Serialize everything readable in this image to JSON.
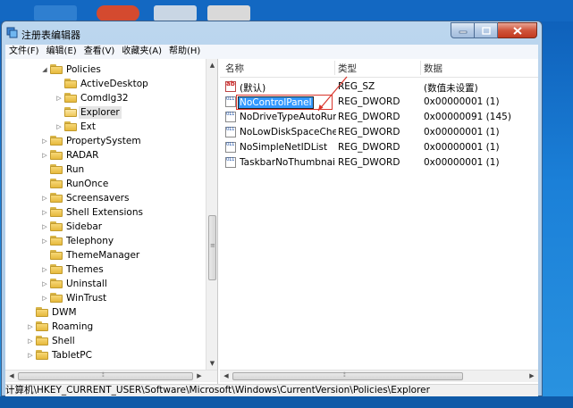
{
  "window": {
    "title": "注册表编辑器"
  },
  "menu": [
    "文件(F)",
    "编辑(E)",
    "查看(V)",
    "收藏夹(A)",
    "帮助(H)"
  ],
  "tree": [
    {
      "label": "Policies",
      "depth": 3,
      "toggle": "expanded",
      "open": false,
      "selected": false
    },
    {
      "label": "ActiveDesktop",
      "depth": 4,
      "toggle": "none",
      "open": false,
      "selected": false
    },
    {
      "label": "Comdlg32",
      "depth": 4,
      "toggle": "collapsed",
      "open": false,
      "selected": false
    },
    {
      "label": "Explorer",
      "depth": 4,
      "toggle": "none",
      "open": true,
      "selected": true
    },
    {
      "label": "Ext",
      "depth": 4,
      "toggle": "collapsed",
      "open": false,
      "selected": false
    },
    {
      "label": "PropertySystem",
      "depth": 3,
      "toggle": "collapsed",
      "open": false,
      "selected": false
    },
    {
      "label": "RADAR",
      "depth": 3,
      "toggle": "collapsed",
      "open": false,
      "selected": false
    },
    {
      "label": "Run",
      "depth": 3,
      "toggle": "none",
      "open": false,
      "selected": false
    },
    {
      "label": "RunOnce",
      "depth": 3,
      "toggle": "none",
      "open": false,
      "selected": false
    },
    {
      "label": "Screensavers",
      "depth": 3,
      "toggle": "collapsed",
      "open": false,
      "selected": false
    },
    {
      "label": "Shell Extensions",
      "depth": 3,
      "toggle": "collapsed",
      "open": false,
      "selected": false
    },
    {
      "label": "Sidebar",
      "depth": 3,
      "toggle": "collapsed",
      "open": false,
      "selected": false
    },
    {
      "label": "Telephony",
      "depth": 3,
      "toggle": "collapsed",
      "open": false,
      "selected": false
    },
    {
      "label": "ThemeManager",
      "depth": 3,
      "toggle": "none",
      "open": false,
      "selected": false
    },
    {
      "label": "Themes",
      "depth": 3,
      "toggle": "collapsed",
      "open": false,
      "selected": false
    },
    {
      "label": "Uninstall",
      "depth": 3,
      "toggle": "collapsed",
      "open": false,
      "selected": false
    },
    {
      "label": "WinTrust",
      "depth": 3,
      "toggle": "collapsed",
      "open": false,
      "selected": false
    },
    {
      "label": "DWM",
      "depth": 2,
      "toggle": "none",
      "open": false,
      "selected": false
    },
    {
      "label": "Roaming",
      "depth": 2,
      "toggle": "collapsed",
      "open": false,
      "selected": false
    },
    {
      "label": "Shell",
      "depth": 2,
      "toggle": "collapsed",
      "open": false,
      "selected": false
    },
    {
      "label": "TabletPC",
      "depth": 2,
      "toggle": "collapsed",
      "open": false,
      "selected": false
    }
  ],
  "columns": {
    "name": "名称",
    "type": "类型",
    "data": "数据"
  },
  "values": [
    {
      "name": "(默认)",
      "type": "REG_SZ",
      "data": "(数值未设置)",
      "icon": "sz",
      "editing": false
    },
    {
      "name": "NoControlPanel",
      "type": "REG_DWORD",
      "data": "0x00000001 (1)",
      "icon": "dw",
      "editing": true
    },
    {
      "name": "NoDriveTypeAutoRun",
      "type": "REG_DWORD",
      "data": "0x00000091 (145)",
      "icon": "dw",
      "editing": false
    },
    {
      "name": "NoLowDiskSpaceChe...",
      "type": "REG_DWORD",
      "data": "0x00000001 (1)",
      "icon": "dw",
      "editing": false
    },
    {
      "name": "NoSimpleNetIDList",
      "type": "REG_DWORD",
      "data": "0x00000001 (1)",
      "icon": "dw",
      "editing": false
    },
    {
      "name": "TaskbarNoThumbnail",
      "type": "REG_DWORD",
      "data": "0x00000001 (1)",
      "icon": "dw",
      "editing": false
    }
  ],
  "status": {
    "path": "计算机\\HKEY_CURRENT_USER\\Software\\Microsoft\\Windows\\CurrentVersion\\Policies\\Explorer"
  },
  "colors": {
    "selection": "#3399ff",
    "annotation": "#d9342b",
    "titlebar": "#bcd6ee",
    "folder": "#e6b93d"
  },
  "icons": {
    "app": "regedit-icon",
    "folder": "folder-icon",
    "string_value": "reg-sz-icon",
    "dword_value": "reg-dword-icon"
  }
}
